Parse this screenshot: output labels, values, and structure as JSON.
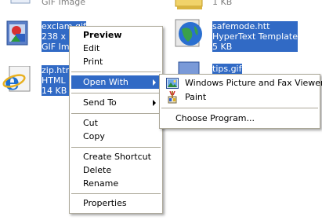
{
  "files": {
    "top_left": {
      "type": "GIF Image"
    },
    "exclam": {
      "name": "exclam.gif",
      "dims": "238 x 2",
      "type": "GIF Imag"
    },
    "zip": {
      "name": "zip.htm",
      "type": "HTML D",
      "size": "14 KB"
    },
    "top_right": {
      "size": "1 KB"
    },
    "safemode": {
      "name": "safemode.htt",
      "type": "HyperText Template",
      "size": "5 KB"
    },
    "tips": {
      "name": "tips.gif"
    }
  },
  "context_menu": {
    "preview": "Preview",
    "edit": "Edit",
    "print": "Print",
    "open_with": "Open With",
    "send_to": "Send To",
    "cut": "Cut",
    "copy": "Copy",
    "create_shortcut": "Create Shortcut",
    "delete": "Delete",
    "rename": "Rename",
    "properties": "Properties"
  },
  "open_with_submenu": {
    "fax_viewer": "Windows Picture and Fax Viewer",
    "paint": "Paint",
    "choose_program": "Choose Program..."
  },
  "colors": {
    "selection": "#316ac5",
    "menu_border": "#aca899",
    "menu_bg": "#ffffff"
  }
}
